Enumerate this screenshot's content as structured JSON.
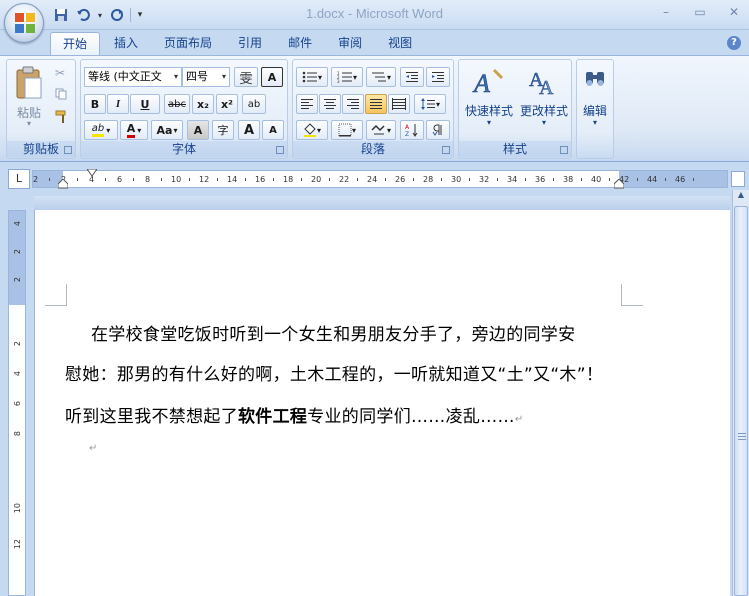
{
  "window": {
    "title": "1.docx - Microsoft Word",
    "controls": [
      "–",
      "▭",
      "✕"
    ]
  },
  "quick_access": [
    "save-icon",
    "undo-icon",
    "redo-icon",
    "customize-icon"
  ],
  "tabs": [
    {
      "label": "开始",
      "active": true
    },
    {
      "label": "插入"
    },
    {
      "label": "页面布局"
    },
    {
      "label": "引用"
    },
    {
      "label": "邮件"
    },
    {
      "label": "审阅"
    },
    {
      "label": "视图"
    }
  ],
  "ribbon": {
    "clipboard": {
      "paste_label": "粘贴",
      "group_label": "剪贴板"
    },
    "font": {
      "font_name": "等线 (中文正文",
      "font_size": "四号",
      "phonetic_btn": "雯",
      "border_btn": "A",
      "bold": "B",
      "italic": "I",
      "underline": "U",
      "strike": "abc",
      "subscript": "x₂",
      "superscript": "x²",
      "clear_btn": "ab",
      "highlight": "ab",
      "font_color": "A",
      "change_case": "Aa",
      "char_shading": "A",
      "enclose": "字",
      "grow": "A",
      "shrink": "A",
      "group_label": "字体"
    },
    "paragraph": {
      "group_label": "段落"
    },
    "styles": {
      "quick_styles": "快速样式",
      "change_styles": "更改样式",
      "group_label": "样式"
    },
    "editing": {
      "label": "编辑"
    }
  },
  "ruler": {
    "corner": "L",
    "h_ticks": [
      "2",
      "2",
      "4",
      "6",
      "8",
      "10",
      "12",
      "14",
      "16",
      "18",
      "20",
      "22",
      "24",
      "26",
      "28",
      "30",
      "32",
      "34",
      "36",
      "38",
      "40",
      "42",
      "44",
      "46"
    ],
    "v_ticks": [
      "4",
      "2",
      "2",
      "2",
      "4",
      "6",
      "8",
      "10",
      "12"
    ]
  },
  "document": {
    "line1": "在学校食堂吃饭时听到一个女生和男朋友分手了，旁边的同学安",
    "line2": "慰她：那男的有什么好的啊，土木工程的，一听就知道又“土”又“木”！",
    "line3_pre": "听到这里我不禁想起了",
    "line3_bold": "软件工程",
    "line3_post": "专业的同学们……凌乱……",
    "pilcrow": "↵"
  }
}
